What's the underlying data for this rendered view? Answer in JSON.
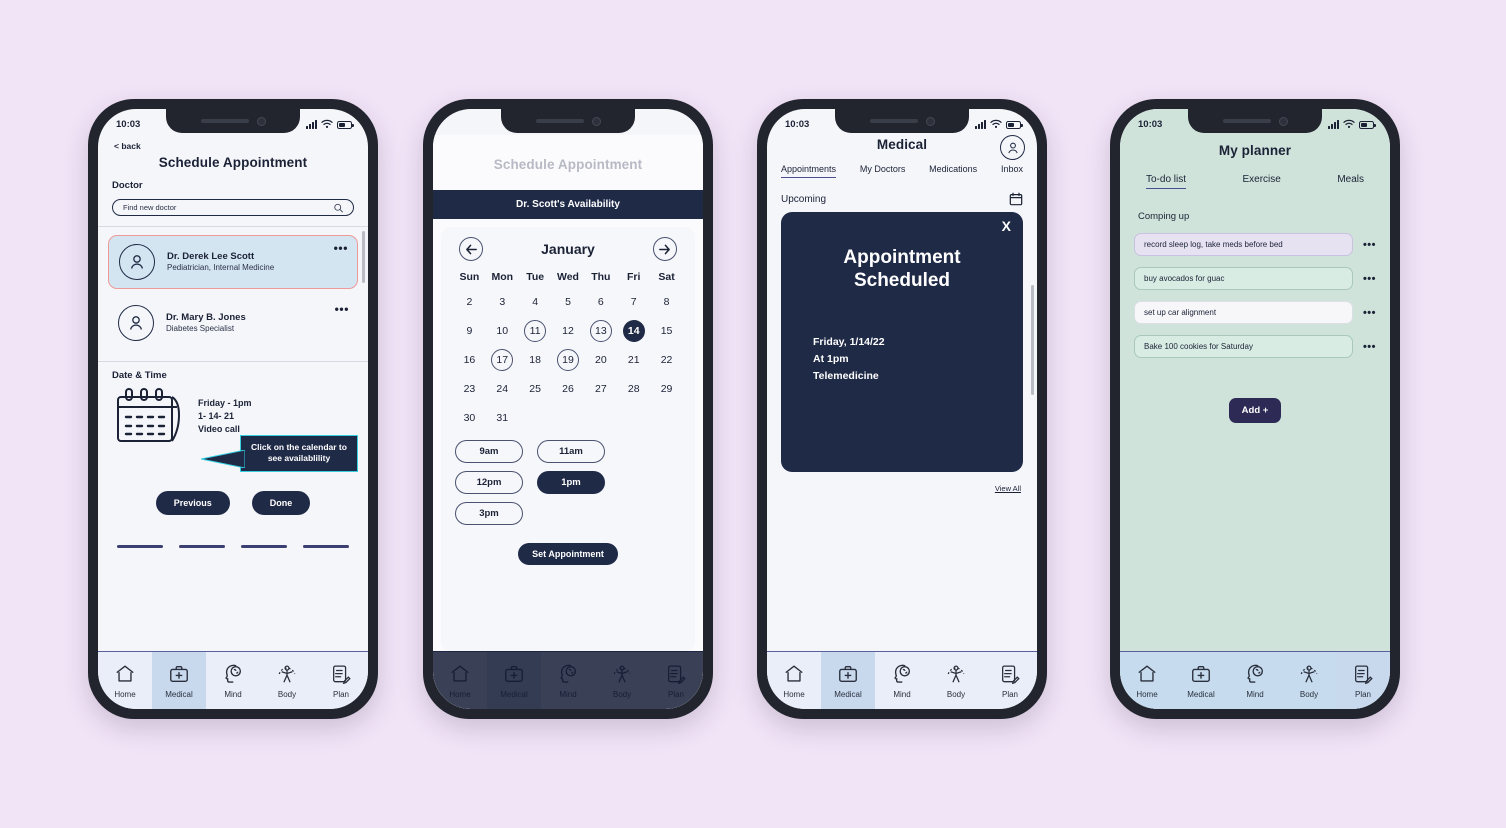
{
  "theme": {
    "page_background": "#f2e4f7",
    "navy": "#1f2a47",
    "mint": "#cfe3da",
    "selected_card": "#d4e5f2",
    "selected_card_border": "#ef9a9a",
    "accent_teal": "#35cfe0"
  },
  "status_bar": {
    "time": "10:03"
  },
  "bottom_nav": {
    "items": [
      {
        "label": "Home",
        "icon": "home-icon"
      },
      {
        "label": "Medical",
        "icon": "medical-kit-icon"
      },
      {
        "label": "Mind",
        "icon": "head-brain-icon"
      },
      {
        "label": "Body",
        "icon": "body-icon"
      },
      {
        "label": "Plan",
        "icon": "clipboard-pencil-icon"
      }
    ]
  },
  "phone1": {
    "back_label": "< back",
    "title": "Schedule Appointment",
    "doctor_section_label": "Doctor",
    "search": {
      "value": "Find new doctor",
      "icon": "search-icon"
    },
    "doctors": [
      {
        "name": "Dr. Derek Lee Scott",
        "specialty": "Pediatrician, Internal Medicine",
        "selected": true,
        "menu": "•••"
      },
      {
        "name": "Dr. Mary B. Jones",
        "specialty": "Diabetes Specialist",
        "selected": false,
        "menu": "•••"
      }
    ],
    "datetime_section_label": "Date & Time",
    "appointment_lines": [
      "Friday - 1pm",
      "1- 14- 21",
      "Video call"
    ],
    "tooltip": "Click on the calendar to see availablility",
    "buttons": {
      "previous": "Previous",
      "done": "Done"
    },
    "progress_steps": 4,
    "active_nav": "Medical"
  },
  "phone2": {
    "title": "Schedule Appointment",
    "availability_header": "Dr. Scott's Availability",
    "month": "January",
    "prev_icon": "arrow-left-icon",
    "next_icon": "arrow-right-icon",
    "day_names": [
      "Sun",
      "Mon",
      "Tue",
      "Wed",
      "Thu",
      "Fri",
      "Sat"
    ],
    "leading_blanks": 0,
    "days": [
      {
        "n": "2"
      },
      {
        "n": "3"
      },
      {
        "n": "4"
      },
      {
        "n": "5"
      },
      {
        "n": "6"
      },
      {
        "n": "7"
      },
      {
        "n": "8"
      },
      {
        "n": "9"
      },
      {
        "n": "10"
      },
      {
        "n": "11",
        "state": "circled"
      },
      {
        "n": "12"
      },
      {
        "n": "13",
        "state": "circled"
      },
      {
        "n": "14",
        "state": "filled"
      },
      {
        "n": "15"
      },
      {
        "n": "16"
      },
      {
        "n": "17",
        "state": "circled"
      },
      {
        "n": "18"
      },
      {
        "n": "19",
        "state": "circled"
      },
      {
        "n": "20"
      },
      {
        "n": "21"
      },
      {
        "n": "22"
      },
      {
        "n": "23"
      },
      {
        "n": "24"
      },
      {
        "n": "25"
      },
      {
        "n": "26"
      },
      {
        "n": "27"
      },
      {
        "n": "28"
      },
      {
        "n": "29"
      },
      {
        "n": "30"
      },
      {
        "n": "31"
      }
    ],
    "time_slots": [
      {
        "label": "9am",
        "selected": false
      },
      {
        "label": "11am",
        "selected": false
      },
      {
        "label": "12pm",
        "selected": false
      },
      {
        "label": "1pm",
        "selected": true
      },
      {
        "label": "3pm",
        "selected": false
      }
    ],
    "set_appointment_label": "Set Appointment",
    "active_nav": "Medical"
  },
  "phone3": {
    "title": "Medical",
    "avatar_icon": "user-avatar-icon",
    "tabs": [
      {
        "label": "Appointments",
        "active": true
      },
      {
        "label": "My Doctors",
        "active": false
      },
      {
        "label": "Medications",
        "active": false
      },
      {
        "label": "Inbox",
        "active": false
      }
    ],
    "upcoming_label": "Upcoming",
    "calendar_icon": "calendar-icon",
    "modal": {
      "close_label": "X",
      "title": "Appointment Scheduled",
      "details": [
        "Friday, 1/14/22",
        "At 1pm",
        "Telemedicine"
      ]
    },
    "view_all_label": "View All",
    "active_nav": "Medical"
  },
  "phone4": {
    "title": "My planner",
    "tabs": [
      {
        "label": "To-do list",
        "active": true
      },
      {
        "label": "Exercise",
        "active": false
      },
      {
        "label": "Meals",
        "active": false
      }
    ],
    "section_label": "Comping up",
    "todos": [
      {
        "text": "record sleep log, take meds before bed",
        "style": "lav",
        "menu": "•••"
      },
      {
        "text": "buy avocados for guac",
        "style": "mint",
        "menu": "•••"
      },
      {
        "text": "set up car alignment",
        "style": "white",
        "menu": "•••"
      },
      {
        "text": "Bake 100 cookies for Saturday",
        "style": "mint",
        "menu": "•••"
      }
    ],
    "add_label": "Add +",
    "active_nav": "Plan"
  }
}
